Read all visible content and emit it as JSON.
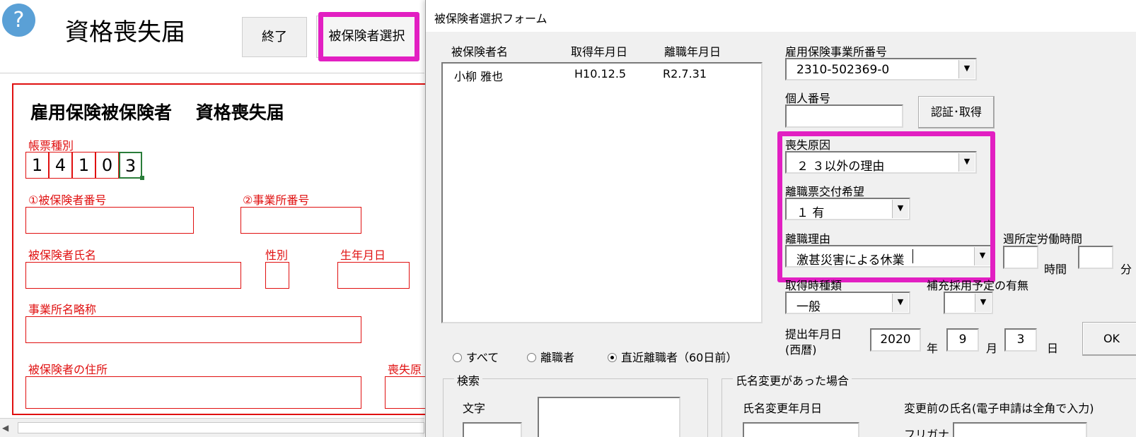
{
  "sheet": {
    "help_icon": "?",
    "title": "資格喪失届",
    "end_button": "終了",
    "select_button": "被保険者選択",
    "form_heading": "雇用保険被保険者　 資格喪失届",
    "form_type_label": "帳票種別",
    "form_type_digits": [
      "1",
      "4",
      "1",
      "0",
      "3"
    ],
    "insured_number_label": "①被保険者番号",
    "office_number_label": "②事業所番号",
    "insured_name_label": "被保険者氏名",
    "sex_label": "性別",
    "birthdate_label": "生年月日",
    "office_abbr_label": "事業所名略称",
    "address_label": "被保険者の住所",
    "loss_cause_partial_label": "喪失原"
  },
  "dialog": {
    "title": "被保険者選択フォーム",
    "list": {
      "headers": [
        "被保険者名",
        "取得年月日",
        "離職年月日"
      ],
      "rows": [
        {
          "name": "小柳 雅也",
          "acquired": "H10.12.5",
          "left": "R2.7.31"
        }
      ]
    },
    "office_number_label": "雇用保険事業所番号",
    "office_number_value": "2310-502369-0",
    "personal_number_label": "個人番号",
    "personal_number_value": "",
    "auth_button": "認証･取得",
    "loss_cause_label": "喪失原因",
    "loss_cause_value": "２ ３以外の理由",
    "separation_slip_label": "離職票交付希望",
    "separation_slip_value": "１ 有",
    "separation_reason_label": "離職理由",
    "separation_reason_value": "激甚災害による休業",
    "weekly_hours_label": "週所定労働時間",
    "hours_unit": "時間",
    "minutes_unit": "分",
    "acq_type_label": "取得時種類",
    "acq_type_value": "一般",
    "replacement_label": "補充採用予定の有無",
    "replacement_value": "",
    "submit_date_label_line1": "提出年月日",
    "submit_date_label_line2": "(西暦)",
    "submit_year": "2020",
    "year_unit": "年",
    "submit_month": "9",
    "month_unit": "月",
    "submit_day": "3",
    "day_unit": "日",
    "ok_button": "OK",
    "filter_all": "すべて",
    "filter_separated": "離職者",
    "filter_recent": "直近離職者（60日前）",
    "search_group": "検索",
    "search_text_label": "文字",
    "name_change_group": "氏名変更があった場合",
    "name_change_date_label": "氏名変更年月日",
    "previous_name_label": "変更前の氏名(電子申請は全角で入力)",
    "furigana_label": "フリガナ"
  },
  "colors": {
    "highlight": "#e21fc2",
    "form_red": "#e01010",
    "selection_green": "#2a7d3a",
    "help_blue": "#5aa0d6"
  }
}
